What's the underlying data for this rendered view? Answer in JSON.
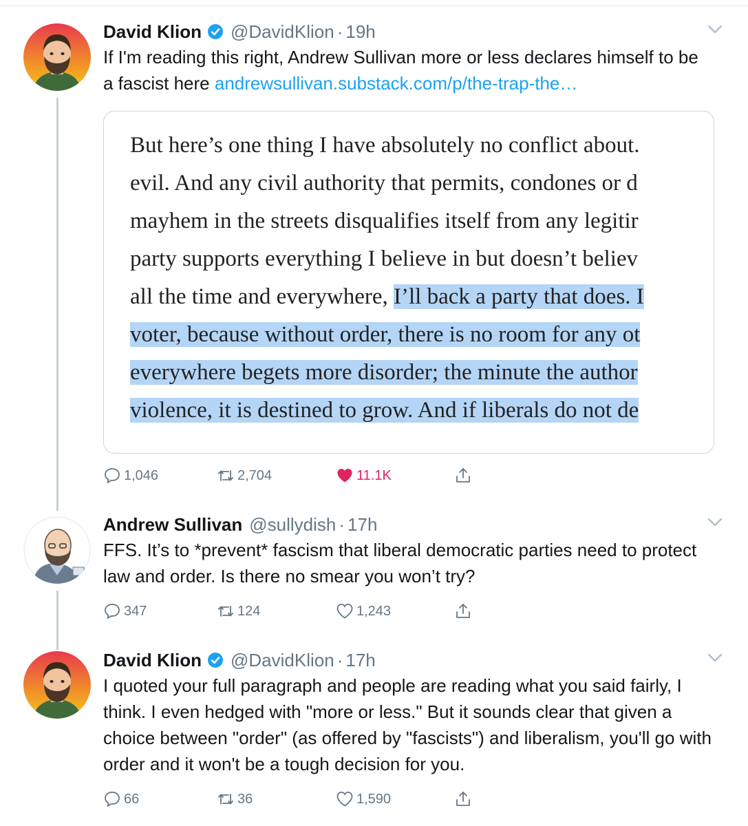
{
  "tweets": [
    {
      "name": "David Klion",
      "handle": "@DavidKlion",
      "sep": "·",
      "time": "19h",
      "verified": true,
      "text": "If I'm reading this right, Andrew Sullivan more or less declares himself to be a fascist here",
      "link": "andrewsullivan.substack.com/p/the-trap-the…",
      "image_quote": {
        "lines": [
          {
            "plain": "But here’s one thing I have absolutely no conflict about. ",
            "highlight": ""
          },
          {
            "plain": "evil. And any civil authority that permits, condones or d",
            "highlight": ""
          },
          {
            "plain": "mayhem in the streets disqualifies itself from any legitir",
            "highlight": ""
          },
          {
            "plain": "party supports everything I believe in but doesn’t believ",
            "highlight": ""
          },
          {
            "plain": "all the time and everywhere, ",
            "highlight": "I’ll back a party that does. I"
          },
          {
            "plain": "",
            "highlight": "voter, because without order, there is no room for any ot"
          },
          {
            "plain": "",
            "highlight": "everywhere begets more disorder; the minute the author"
          },
          {
            "plain": "",
            "highlight": "violence, it is destined to grow. And if liberals do not de"
          }
        ]
      },
      "replies": "1,046",
      "retweets": "2,704",
      "likes": "11.1K",
      "liked": true
    },
    {
      "name": "Andrew Sullivan",
      "handle": "@sullydish",
      "sep": "·",
      "time": "17h",
      "verified": false,
      "text": "FFS. It’s to *prevent* fascism that liberal democratic parties need to protect law and order. Is there no smear you won’t try?",
      "replies": "347",
      "retweets": "124",
      "likes": "1,243",
      "liked": false
    },
    {
      "name": "David Klion",
      "handle": "@DavidKlion",
      "sep": "·",
      "time": "17h",
      "verified": true,
      "text": "I quoted your full paragraph and people are reading what you said fairly, I think. I even hedged with \"more or less.\" But it sounds clear that given a choice between \"order\" (as offered by \"fascists\") and liberalism, you'll go with order and it won't be a tough decision for you.",
      "replies": "66",
      "retweets": "36",
      "likes": "1,590",
      "liked": false
    }
  ],
  "colors": {
    "link": "#1da1f2",
    "like_active": "#e0245e",
    "muted": "#657786",
    "highlight": "#b4d5f6"
  }
}
